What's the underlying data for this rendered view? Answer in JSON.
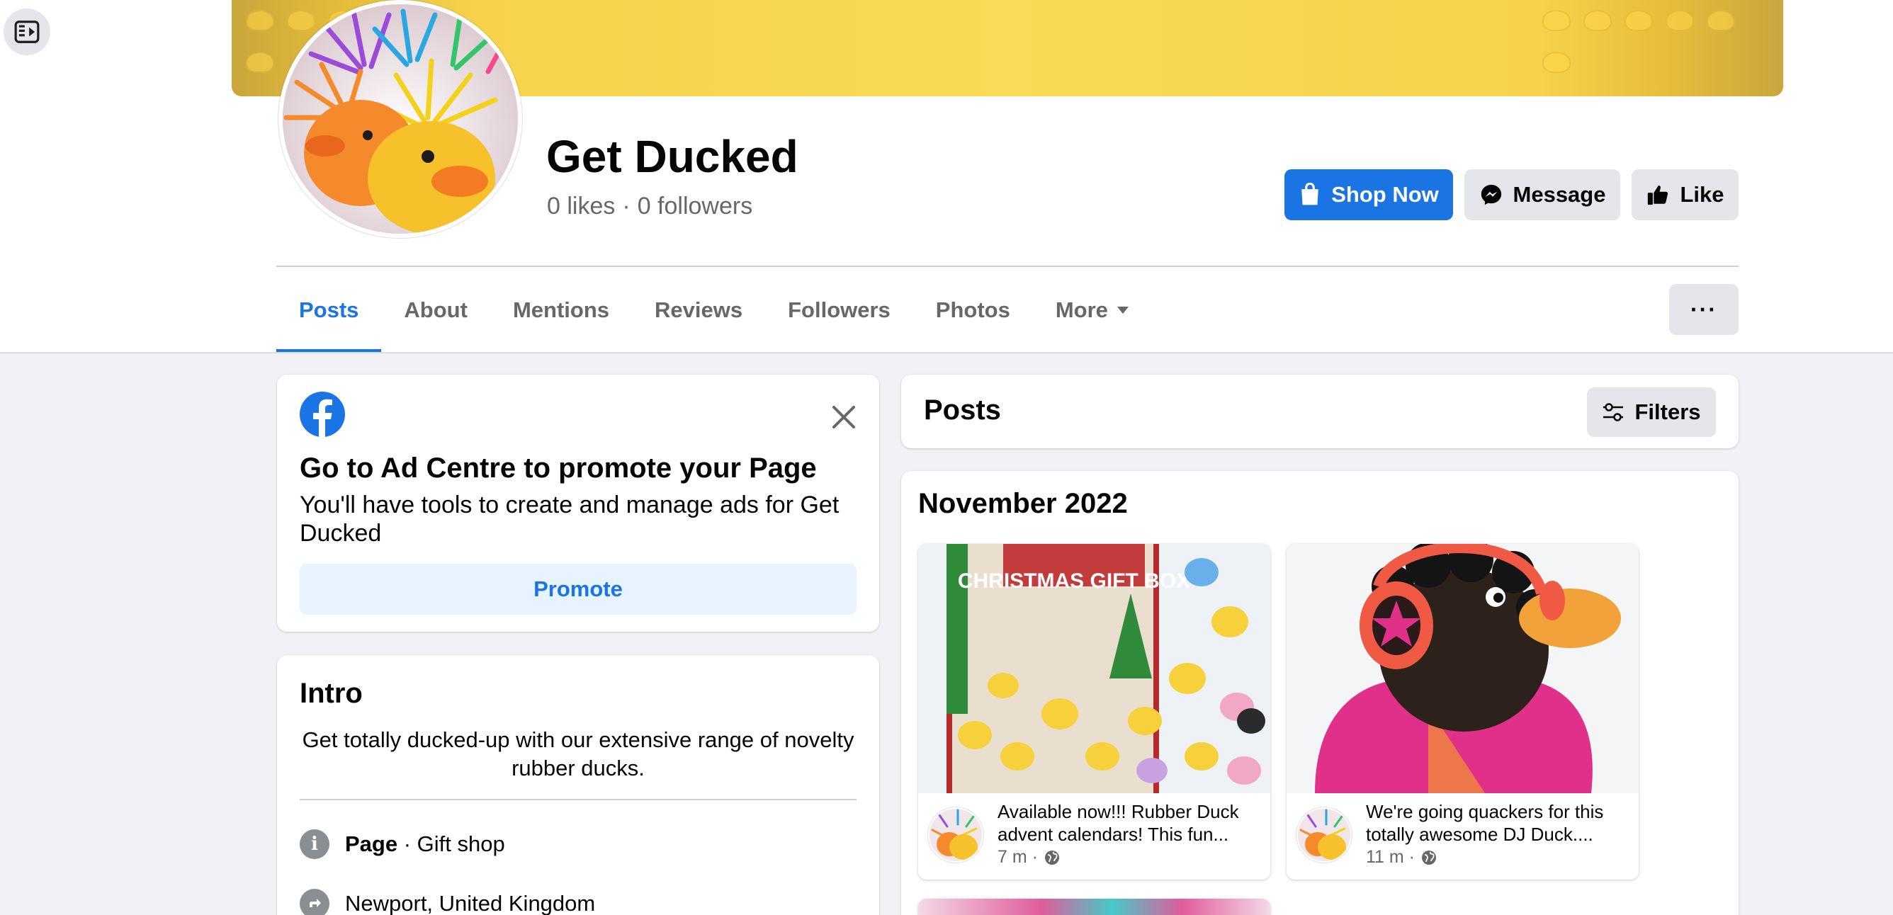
{
  "page": {
    "name": "Get Ducked",
    "likes": "0 likes",
    "separator": "·",
    "followers": "0 followers"
  },
  "actions": {
    "shop_now": "Shop Now",
    "message": "Message",
    "like": "Like"
  },
  "tabs": [
    {
      "label": "Posts",
      "active": true
    },
    {
      "label": "About"
    },
    {
      "label": "Mentions"
    },
    {
      "label": "Reviews"
    },
    {
      "label": "Followers"
    },
    {
      "label": "Photos"
    },
    {
      "label": "More"
    }
  ],
  "more_actions": "···",
  "ad_centre": {
    "heading": "Go to Ad Centre to promote your Page",
    "body": "You'll have tools to create and manage ads for Get Ducked",
    "button": "Promote"
  },
  "intro": {
    "heading": "Intro",
    "bio": "Get totally ducked-up with our extensive range of novelty rubber ducks.",
    "category_label": "Page",
    "category_value": " · Gift shop",
    "location": "Newport, United Kingdom"
  },
  "posts": {
    "heading": "Posts",
    "filters": "Filters",
    "month": "November 2022",
    "items": [
      {
        "text": "Available now!!! Rubber Duck advent calendars! This fun...",
        "time": "7 m ·",
        "image_text": "CHRISTMAS GIFT BOX"
      },
      {
        "text": "We're going quackers for this totally awesome DJ Duck....",
        "time": "11 m ·"
      }
    ]
  },
  "colors": {
    "primary": "#1b74e4",
    "secondary_button": "#e4e6eb",
    "muted_text": "#65676b",
    "background": "#f0f2f5"
  }
}
